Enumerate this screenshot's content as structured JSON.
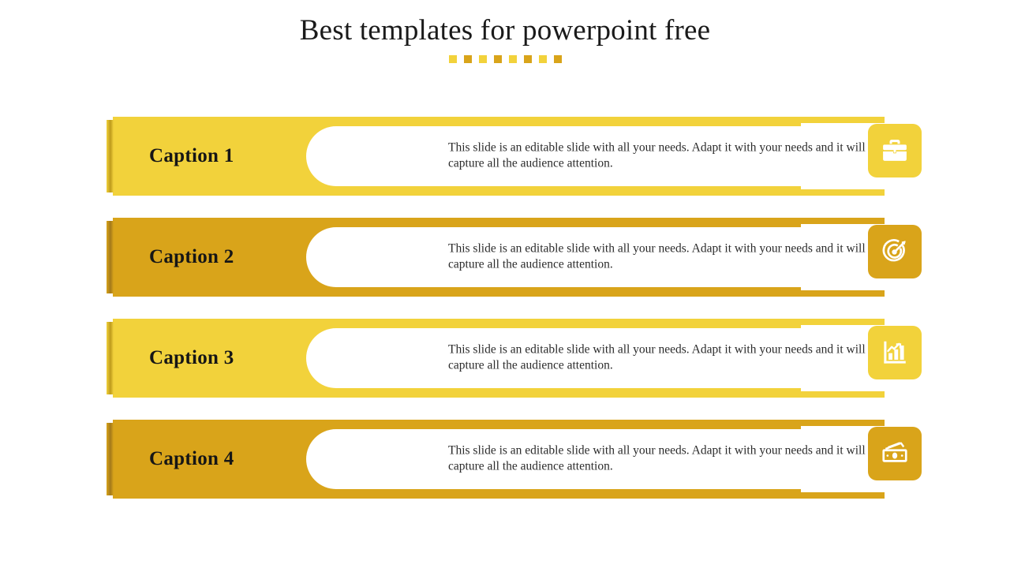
{
  "title": "Best templates for powerpoint free",
  "decor": {
    "squares": [
      {
        "color": "#F2D23B"
      },
      {
        "color": "#D9A41A"
      },
      {
        "color": "#F2D23B"
      },
      {
        "color": "#D9A41A"
      },
      {
        "color": "#F2D23B"
      },
      {
        "color": "#D9A41A"
      },
      {
        "color": "#F2D23B"
      },
      {
        "color": "#D9A41A"
      }
    ]
  },
  "colors": {
    "light_yellow": "#F2D23B",
    "dark_gold": "#D9A41A",
    "light_yellow_edge": "#BE9B1C",
    "dark_gold_edge": "#A3791A",
    "title_text": "#1A1A1A",
    "body_text": "#2B2B2B",
    "background": "#FFFFFF"
  },
  "body_copy": "This slide is an editable slide with all your needs. Adapt it with your needs and it will capture all the audience attention.",
  "rows": [
    {
      "caption": "Caption 1",
      "body": "This slide is an editable slide with all your needs. Adapt it with your needs and it will capture all the audience attention.",
      "icon": "briefcase-icon",
      "color": "#F2D23B",
      "edge_color": "#BE9B1C"
    },
    {
      "caption": "Caption 2",
      "body": "This slide is an editable slide with all your needs. Adapt it with your needs and it will capture all the audience attention.",
      "icon": "target-arrow-icon",
      "color": "#D9A41A",
      "edge_color": "#A3791A"
    },
    {
      "caption": "Caption 3",
      "body": "This slide is an editable slide with all your needs. Adapt it with your needs and it will capture all the audience attention.",
      "icon": "bar-chart-growth-icon",
      "color": "#F2D23B",
      "edge_color": "#BE9B1C"
    },
    {
      "caption": "Caption 4",
      "body": "This slide is an editable slide with all your needs. Adapt it with your needs and it will capture all the audience attention.",
      "icon": "money-cash-icon",
      "color": "#D9A41A",
      "edge_color": "#A3791A"
    }
  ]
}
